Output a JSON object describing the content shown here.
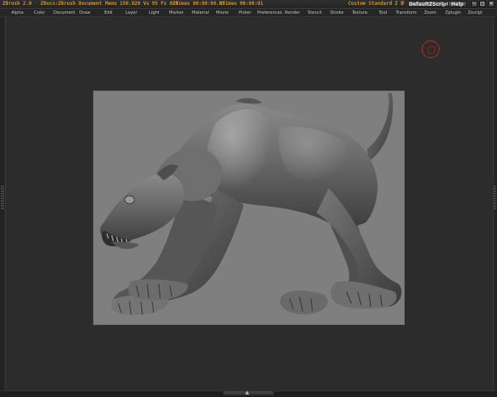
{
  "titlebar": {
    "app_name": "ZBrush 2.0",
    "document": "ZDocs:ZBrush Document",
    "memory": "Mems 150.020 Vs 95 Fs 020",
    "ztimes": "ZTimes 00:00:00.05",
    "rtimes": "RTimes 00:00:01",
    "layout_label": "Custom  Standard Z D",
    "help_marker": "?",
    "default_zscript_button": "DefaultZScript",
    "help_button": "Help",
    "window_buttons": [
      "minimize-icon",
      "restore-icon",
      "close-icon"
    ]
  },
  "menubar": {
    "items": [
      "Alpha",
      "Color",
      "Document",
      "Draw",
      "Edit",
      "Layer",
      "Light",
      "Marker",
      "Material",
      "Movie",
      "Picker",
      "Preferences",
      "Render",
      "Stencil",
      "Stroke",
      "Texture",
      "Tool",
      "Transform",
      "Zoom",
      "Zplugin",
      "Zscript"
    ]
  },
  "canvas": {
    "background_color": "#2c2c2c",
    "document_color": "#7f7f7f",
    "model_subject": "sculpted quadruped creature (dog/wolf) in stretching pose",
    "cursor_color": "#c02a2a"
  },
  "colors": {
    "accent_orange": "#d9902a",
    "menu_text": "#c8c8c8"
  }
}
